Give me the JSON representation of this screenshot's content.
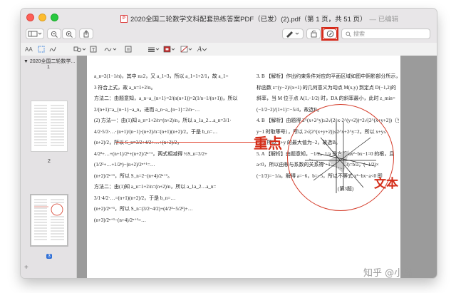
{
  "window": {
    "title": "2020全国二轮数学文科配套热练答案PDF（已发）(2).pdf（第 1 页，共 51 页）",
    "edited_label": "— 已编辑"
  },
  "toolbar": {
    "search_placeholder": "搜索",
    "highlighted_button_color": "#d62a1a"
  },
  "toolbar2": {
    "text_tool": "AA",
    "font_tool": "A"
  },
  "sidebar": {
    "heading": "2020全国二轮数学...",
    "pages": [
      "1",
      "2",
      "3"
    ],
    "plus": "+"
  },
  "annotations": {
    "key_point": "重点",
    "text_label": "文本",
    "color": "#d42e1a"
  },
  "watermark": "知乎 @小岛",
  "document": {
    "left_column": [
      "a_n=2(1−1/n)，其中 n≥2，又 a_1=3，所以 a_1=1+2/1，故 a_1=",
      "3 符合上式，故 a_n=1+2/n。",
      "方法二：由题意知，a_n−a_{n+1}=2/(n(n+1))=2(1/n−1/(n+1))，所以",
      "2/(n+1)=a_{n−1}−a_n，进而 a_n−a_{n−1}=2/n−…",
      "(2) 方法一：由(1)知 a_n=1+2/n=(n+2)/n，所以 a_1a_2…a_n=3/1·",
      "4/2·5/3·…·(n+1)/(n−1)·(n+2)/n=(n+1)(n+2)/2，于是 b_n=…",
      "(n+2)/2，所以 S_n=3/2+4/2+…+(n+2)/2，",
      "4/2²+…+(n+1)/2ⁿ+(n+2)/2ⁿ⁺¹，两式相减得 ½S_n=3/2+",
      "(1/2²+…+1/2ⁿ)−(n+2)/2ⁿ⁺¹=…",
      "(n+2)/2ⁿ⁺¹，所以 S_n=2−(n+4)/2ⁿ⁺¹。",
      "方法二：由(1)知 a_n=1+2/n=(n+2)/n，所以 a_1a_2…a_n=",
      "3/1·4/2·…=(n+1)(n+2)/2，于是 b_n=…",
      "(n+2)/2ⁿ⁺¹，所以 S_n=(3/2−4/2)+(4/2²−5/2²)+…",
      "(n+3)/2ⁿ⁺¹−(n+4)/2ⁿ⁺¹=…"
    ],
    "right_column": [
      "3. B 【解析】作出约束条件对应的平面区域如图中阴影部分所示，目",
      "标函数 z=(y−2)/(x+1) 的几何意义为动点 M(x,y) 到定点 D(−1,2)的",
      "斜率，当 M 位于点 A(1,−1/2) 时，DA 的斜率最小，此时 z_min=",
      "(−1/2−2)/(1+1)=−5/4，故选B。",
      "",
      "",
      "",
      "",
      "",
      "",
      "",
      "4. B 【解析】由题得 2^(x+2^y)≥2√(2^x·2^(y+2))=2√(2^(x+y+2))（当且仅当 x=",
      "y−1 时取等号），所以 2√(2^(x+y+2))≤2^x+2^y=2，所以 x+y≤",
      "−2，所以 x+y 的最大值为−2，故选B。",
      "5. A 【解析】由题意知，−1/2，1/a 是方程 ax²−bx−1=0 的根，且",
      "a<0，所以由根与系数的关系得 −1/2+(−1/3)=b/a，(−1/2)×",
      "(−1/3)=−1/a，解得 a=−6，b=−5，所以不等式 x²−bx−a<0 即"
    ],
    "figure_caption": "(第3题)"
  }
}
